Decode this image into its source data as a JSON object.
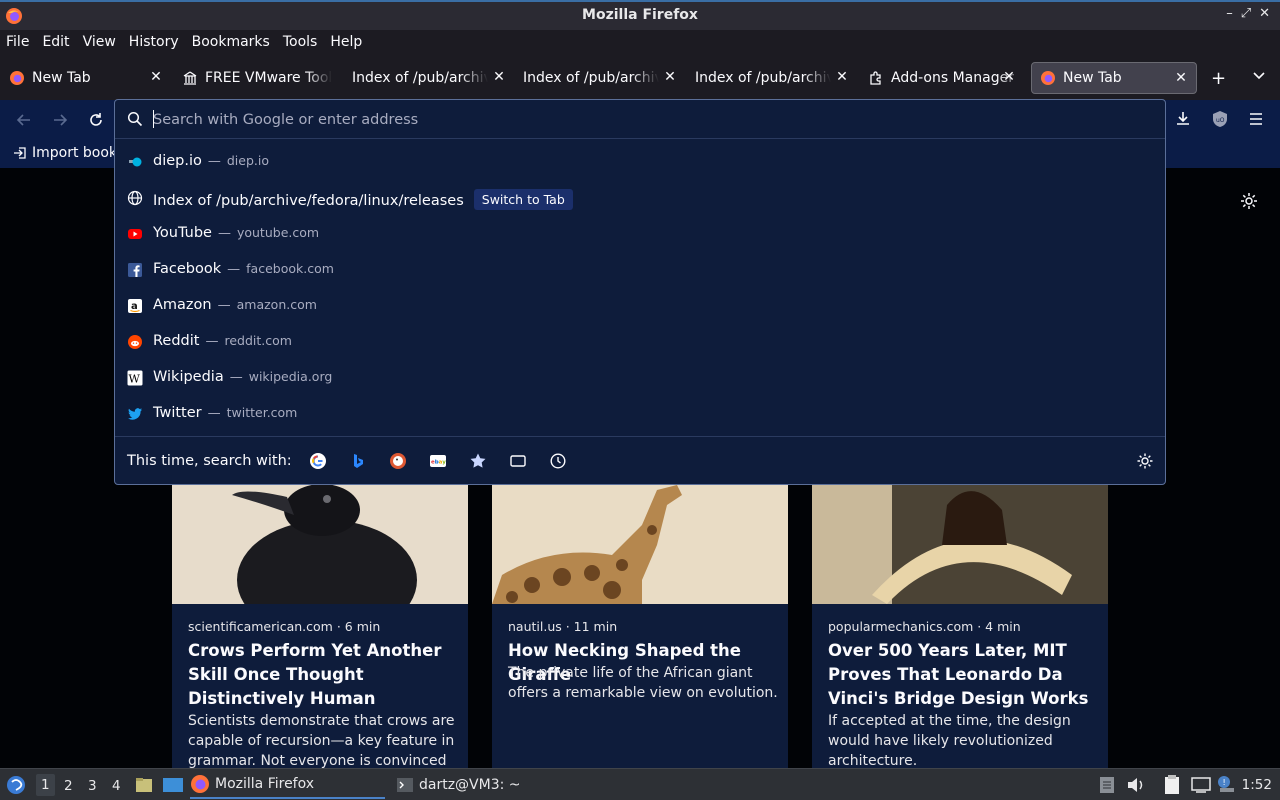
{
  "window": {
    "title": "Mozilla Firefox"
  },
  "menu": [
    "File",
    "Edit",
    "View",
    "History",
    "Bookmarks",
    "Tools",
    "Help"
  ],
  "tabs": [
    {
      "label": "New Tab",
      "icon": "firefox-icon"
    },
    {
      "label": "FREE VMware Tools",
      "icon": "building-icon"
    },
    {
      "label": "Index of /pub/archive",
      "icon": "none"
    },
    {
      "label": "Index of /pub/archive",
      "icon": "none"
    },
    {
      "label": "Index of /pub/archive",
      "icon": "none"
    },
    {
      "label": "Add-ons Manager",
      "icon": "puzzle-icon"
    },
    {
      "label": "New Tab",
      "icon": "firefox-icon",
      "active": true
    }
  ],
  "bookmarks": {
    "import_label": "Import book"
  },
  "urlbar": {
    "placeholder": "Search with Google or enter address",
    "results": [
      {
        "title": "diep.io",
        "url": "diep.io",
        "icon": "diep-icon"
      },
      {
        "title": "Index of /pub/archive/fedora/linux/releases",
        "badge": "Switch to Tab",
        "icon": "globe-icon"
      },
      {
        "title": "YouTube",
        "url": "youtube.com",
        "icon": "youtube-icon"
      },
      {
        "title": "Facebook",
        "url": "facebook.com",
        "icon": "facebook-icon"
      },
      {
        "title": "Amazon",
        "url": "amazon.com",
        "icon": "amazon-icon"
      },
      {
        "title": "Reddit",
        "url": "reddit.com",
        "icon": "reddit-icon"
      },
      {
        "title": "Wikipedia",
        "url": "wikipedia.org",
        "icon": "wikipedia-icon"
      },
      {
        "title": "Twitter",
        "url": "twitter.com",
        "icon": "twitter-icon"
      }
    ],
    "dash": "—",
    "oneoff_label": "This time, search with:",
    "oneoff_engines": [
      "google-icon",
      "bing-icon",
      "duckduckgo-icon",
      "ebay-icon",
      "bookmarks-star-icon",
      "tabs-icon",
      "history-clock-icon"
    ]
  },
  "stories": [
    {
      "source": "scientificamerican.com · 6 min",
      "headline": "Crows Perform Yet Another Skill Once Thought Distinctively Human",
      "description": "Scientists demonstrate that crows are capable of recursion—a key feature in grammar. Not everyone is convinced"
    },
    {
      "source": "nautil.us · 11 min",
      "headline": "How Necking Shaped the Giraffe",
      "description": "The private life of the African giant offers a remarkable view on evolution."
    },
    {
      "source": "popularmechanics.com · 4 min",
      "headline": "Over 500 Years Later, MIT Proves That Leonardo Da Vinci's Bridge Design Works",
      "description": "If accepted at the time, the design would have likely revolutionized architecture."
    }
  ],
  "taskbar": {
    "workspaces": [
      "1",
      "2",
      "3",
      "4"
    ],
    "tasks": [
      {
        "label": "Mozilla Firefox",
        "active": true
      },
      {
        "label": "dartz@VM3: ~"
      }
    ],
    "clock": "1:52"
  },
  "colors": {
    "accent": "#3a6ea5",
    "popup_bg": "#0e1c3b",
    "toolbar_bg": "#0b1c47",
    "switch_badge": "#1b2f6b"
  }
}
